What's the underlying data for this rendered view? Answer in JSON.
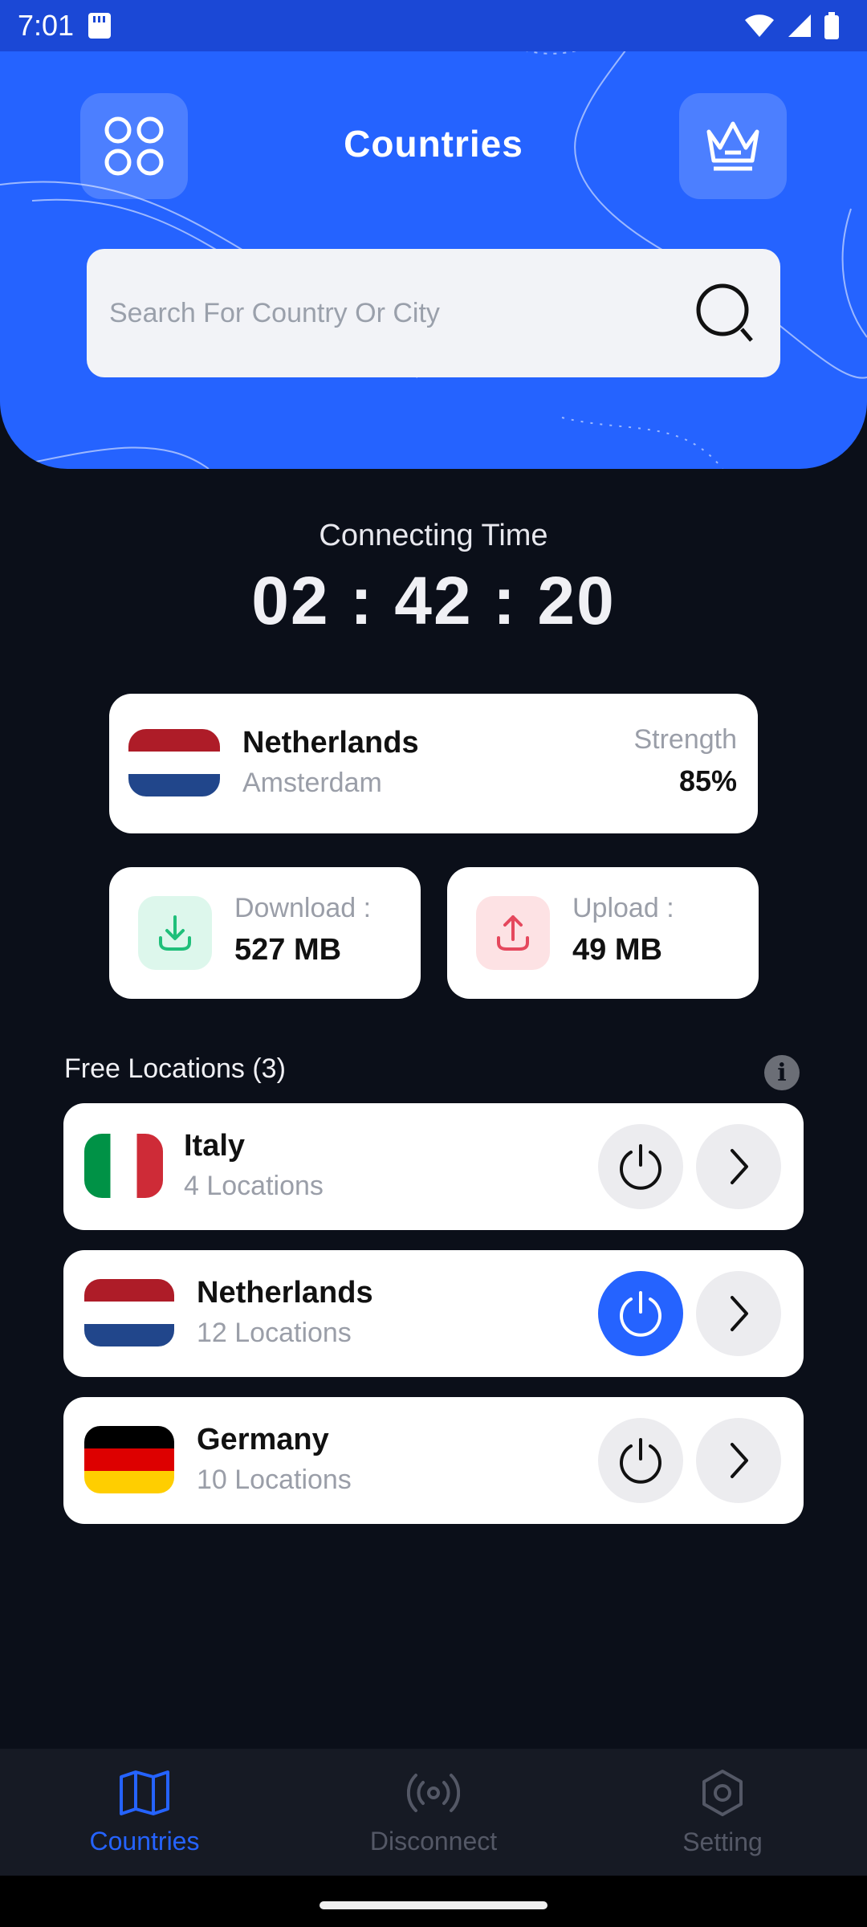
{
  "status_bar": {
    "time": "7:01"
  },
  "header": {
    "title": "Countries",
    "search": {
      "placeholder": "Search For Country Or City",
      "value": ""
    }
  },
  "connection": {
    "label": "Connecting Time",
    "timer": "02 : 42 : 20"
  },
  "current_server": {
    "country": "Netherlands",
    "city": "Amsterdam",
    "strength_label": "Strength",
    "strength_value": "85%"
  },
  "stats": {
    "download": {
      "label": "Download :",
      "value": "527 MB"
    },
    "upload": {
      "label": "Upload :",
      "value": "49 MB"
    }
  },
  "locations": {
    "title": "Free Locations (3)",
    "items": [
      {
        "name": "Italy",
        "count": "4 Locations",
        "flag": "italy-flag",
        "connected": false
      },
      {
        "name": "Netherlands",
        "count": "12 Locations",
        "flag": "netherlands-flag",
        "connected": true
      },
      {
        "name": "Germany",
        "count": "10 Locations",
        "flag": "germany-flag",
        "connected": false
      }
    ]
  },
  "bottom_nav": {
    "items": [
      {
        "label": "Countries",
        "icon": "map-icon",
        "active": true
      },
      {
        "label": "Disconnect",
        "icon": "broadcast-icon",
        "active": false
      },
      {
        "label": "Setting",
        "icon": "hexagon-gear-icon",
        "active": false
      }
    ]
  },
  "colors": {
    "accent": "#2563ff",
    "background": "#0b0f19",
    "download_green": "#1fbf7a",
    "upload_red": "#e5485d"
  }
}
